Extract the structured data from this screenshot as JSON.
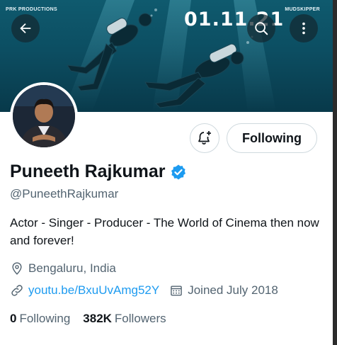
{
  "banner": {
    "tag_left": "PRK PRODUCTIONS",
    "tag_right": "MUDSKIPPER",
    "date_text": "01.11.21",
    "bg_color": "#0c4e62"
  },
  "nav": {
    "back_icon": "arrow-left-icon",
    "search_icon": "search-icon",
    "more_icon": "more-vertical-icon"
  },
  "profile": {
    "display_name": "Puneeth Rajkumar",
    "verified": true,
    "handle": "@PuneethRajkumar",
    "bio": "Actor - Singer - Producer - The World of Cinema then now and forever!",
    "location": "Bengaluru, India",
    "website": "youtu.be/BxuUvAmg52Y",
    "joined": "Joined July 2018"
  },
  "actions": {
    "notify_icon": "bell-plus-icon",
    "follow_label": "Following"
  },
  "stats": {
    "following_count": "0",
    "following_label": "Following",
    "followers_count": "382K",
    "followers_label": "Followers"
  },
  "colors": {
    "accent": "#1d9bf0",
    "text_primary": "#0f1419",
    "text_secondary": "#536471"
  }
}
